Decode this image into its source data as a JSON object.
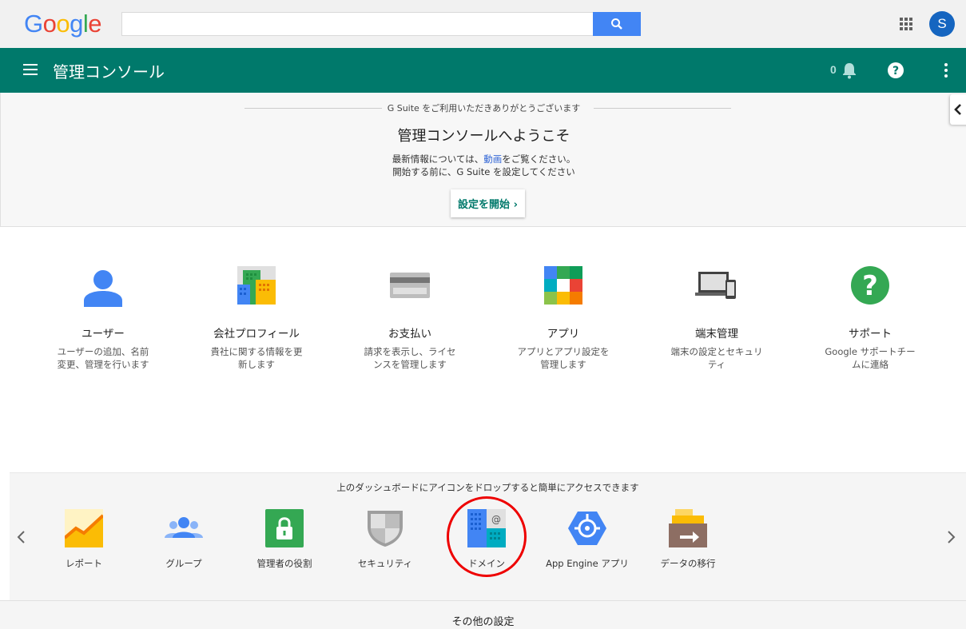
{
  "topbar": {
    "logo_letters": [
      {
        "ch": "G",
        "color": "#4285f4"
      },
      {
        "ch": "o",
        "color": "#ea4335"
      },
      {
        "ch": "o",
        "color": "#fbbc05"
      },
      {
        "ch": "g",
        "color": "#4285f4"
      },
      {
        "ch": "l",
        "color": "#34a853"
      },
      {
        "ch": "e",
        "color": "#ea4335"
      }
    ],
    "search_value": "",
    "search_placeholder": "",
    "avatar_initial": "S"
  },
  "header": {
    "title": "管理コンソール",
    "notification_count": "0",
    "bg_color": "#00796b"
  },
  "welcome": {
    "tagline": "G Suite をご利用いただきありがとうございます",
    "title": "管理コンソールへようこそ",
    "line1_prefix": "最新情報については、",
    "line1_link": "動画",
    "line1_suffix": "をご覧ください。",
    "line2": "開始する前に、G Suite を設定してください",
    "start_button": "設定を開始 ›"
  },
  "tiles": [
    {
      "title": "ユーザー",
      "desc": "ユーザーの追加、名前変更、管理を行います",
      "icon": "user-icon"
    },
    {
      "title": "会社プロフィール",
      "desc": "貴社に関する情報を更新します",
      "icon": "company-icon"
    },
    {
      "title": "お支払い",
      "desc": "請求を表示し、ライセンスを管理します",
      "icon": "billing-icon"
    },
    {
      "title": "アプリ",
      "desc": "アプリとアプリ設定を管理します",
      "icon": "apps-grid-icon"
    },
    {
      "title": "端末管理",
      "desc": "端末の設定とセキュリティ",
      "icon": "devices-icon"
    },
    {
      "title": "サポート",
      "desc": "Google サポートチームに連絡",
      "icon": "support-icon"
    }
  ],
  "dock": {
    "hint": "上のダッシュボードにアイコンをドロップすると簡単にアクセスできます",
    "items": [
      {
        "label": "レポート",
        "icon": "reports-icon"
      },
      {
        "label": "グループ",
        "icon": "groups-icon"
      },
      {
        "label": "管理者の役割",
        "icon": "admin-roles-icon"
      },
      {
        "label": "セキュリティ",
        "icon": "security-icon"
      },
      {
        "label": "ドメイン",
        "icon": "domains-icon"
      },
      {
        "label": "App Engine アプリ",
        "icon": "app-engine-icon"
      },
      {
        "label": "データの移行",
        "icon": "data-migration-icon"
      }
    ],
    "highlighted_item": "ドメイン"
  },
  "footer": {
    "label": "その他の設定"
  }
}
